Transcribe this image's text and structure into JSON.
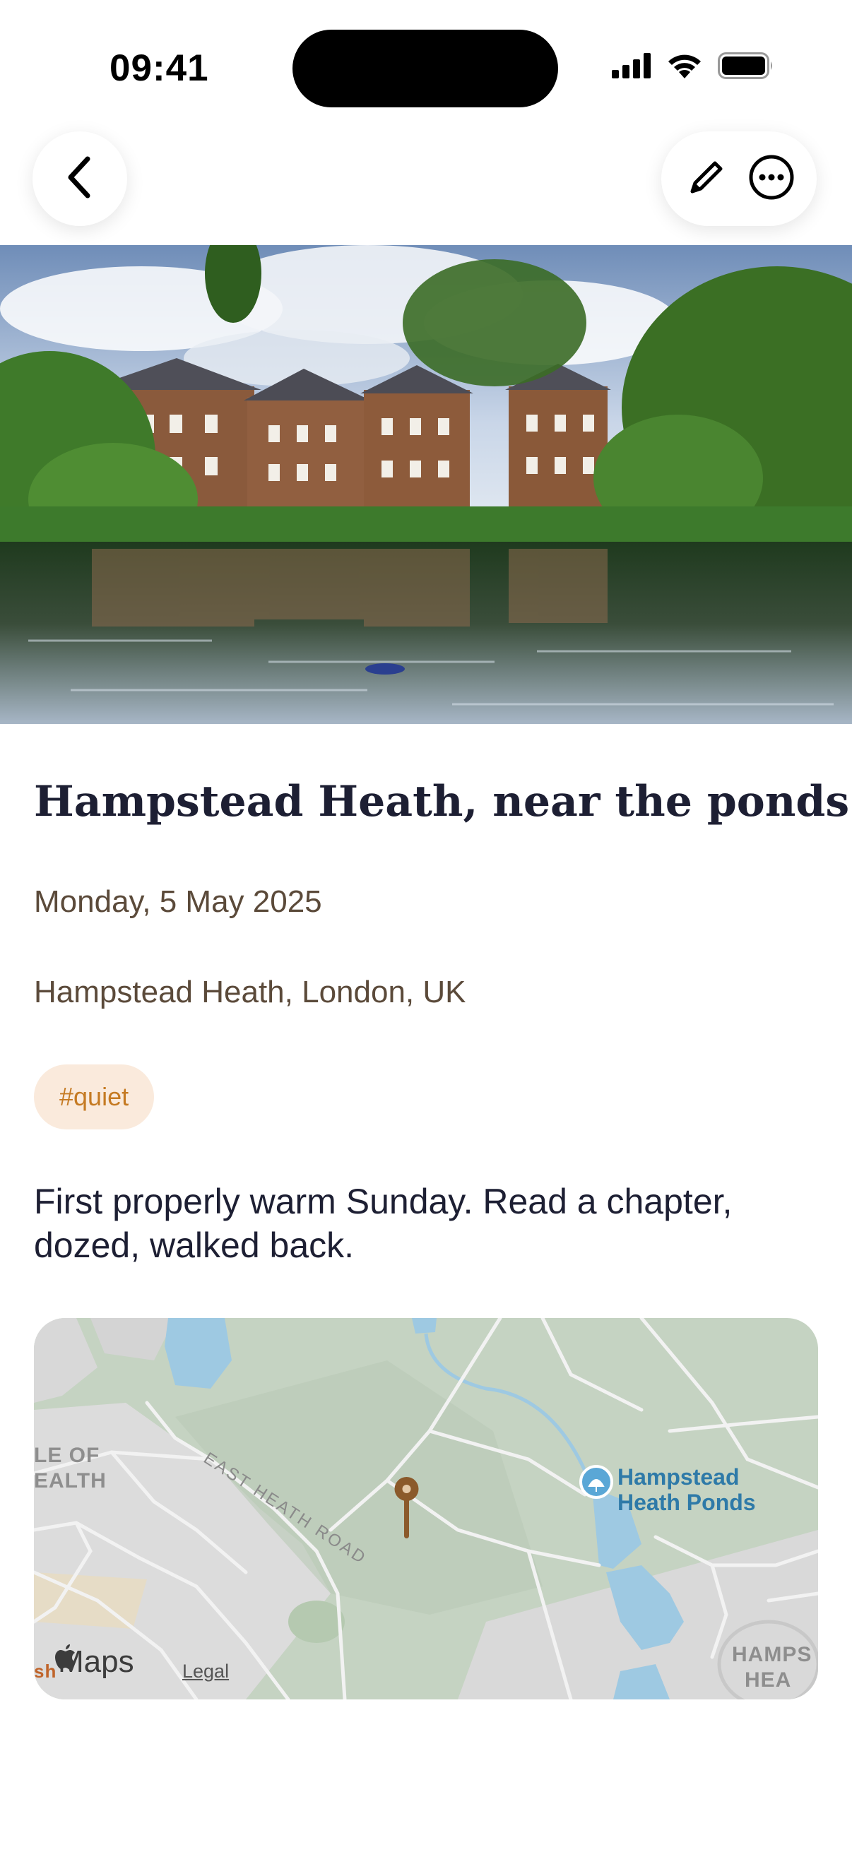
{
  "status_bar": {
    "time": "09:41",
    "icons": [
      "signal-icon",
      "wifi-icon",
      "battery-icon"
    ]
  },
  "nav": {
    "back_icon": "chevron-left-icon",
    "edit_icon": "pencil-icon",
    "more_icon": "ellipsis-circle-icon"
  },
  "hero": {
    "page_count": 1,
    "current_page": 1
  },
  "entry": {
    "title": "Hampstead Heath, near the ponds",
    "date": "Monday, 5 May 2025",
    "location": "Hampstead Heath, London, UK",
    "tags": [
      "#quiet"
    ],
    "body": "First properly warm Sunday. Read a chapter, dozed, walked back."
  },
  "map": {
    "poi_line1": "Hampstead",
    "poi_line2": "Heath Ponds",
    "road": "EAST HEATH ROAD",
    "area_left_1": "LE OF",
    "area_left_2": "EALTH",
    "area_right_1": "HAMPS",
    "area_right_2": "HEA",
    "edge_text": "sh",
    "brand": "Maps",
    "legal": "Legal"
  },
  "colors": {
    "title": "#1d1f33",
    "meta": "#5b4a3a",
    "tag_bg": "#faeadc",
    "tag_text": "#c57a22",
    "pin": "#8b5a2b",
    "water": "#9ec9e2"
  }
}
